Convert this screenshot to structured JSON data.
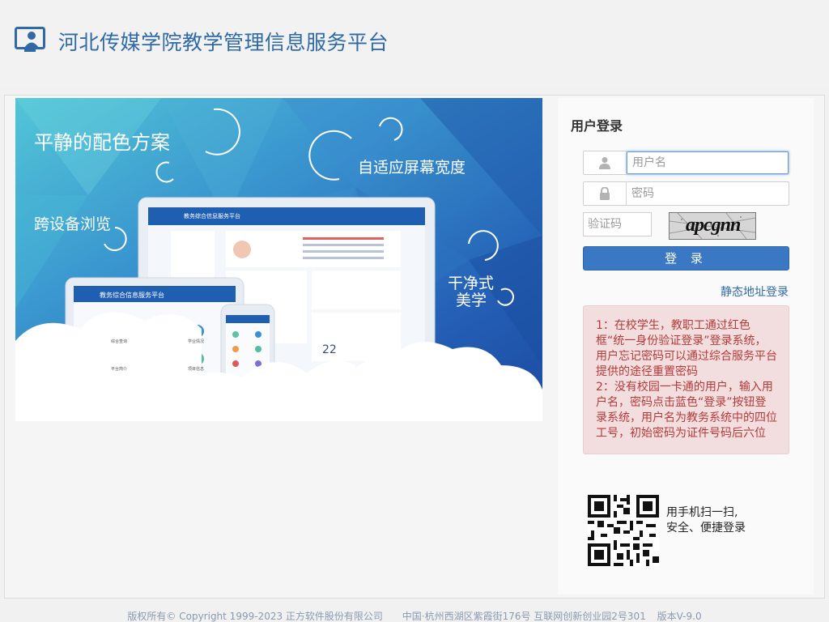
{
  "header": {
    "title": "河北传媒学院教学管理信息服务平台",
    "logo_icon": "person-monitor-icon",
    "accent_color": "#2f6aa6"
  },
  "banner": {
    "slogan_1": "平静的配色方案",
    "slogan_2": "自适应屏幕宽度",
    "slogan_3": "跨设备浏览",
    "slogan_4_line1": "干净式",
    "slogan_4_line2": "美学",
    "device_title_laptop": "教务综合信息服务平台",
    "device_title_tablet": "教务综合信息服务平台",
    "tablet_menu": [
      "综合查询",
      "学业情况",
      "平台简介",
      "项目信息"
    ],
    "calendar_day": "22"
  },
  "login": {
    "title": "用户登录",
    "username_placeholder": "用户名",
    "password_placeholder": "密码",
    "captcha_placeholder": "验证码",
    "captcha_text": "apcgnn",
    "submit_label": "登 录",
    "static_link": "静态地址登录",
    "notice_1": "1：在校学生，教职工通过红色框“统一身份验证登录”登录系统，用户忘记密码可以通过综合服务平台提供的途径重置密码",
    "notice_2": "2：没有校园一卡通的用户，输入用户名，密码点击蓝色“登录”按钮登录系统，用户名为教务系统中的四位工号，初始密码为证件号码后六位",
    "button_color": "#3a78c3",
    "notice_color": "#b43a3a"
  },
  "qr": {
    "line1": "用手机扫一扫,",
    "line2": "安全、便捷登录"
  },
  "footer": {
    "copyright": "版权所有© Copyright 1999-2023 正方软件股份有限公司",
    "address": "中国·杭州西湖区紫霞街176号 互联网创新创业园2号301",
    "version": "版本V-9.0"
  }
}
